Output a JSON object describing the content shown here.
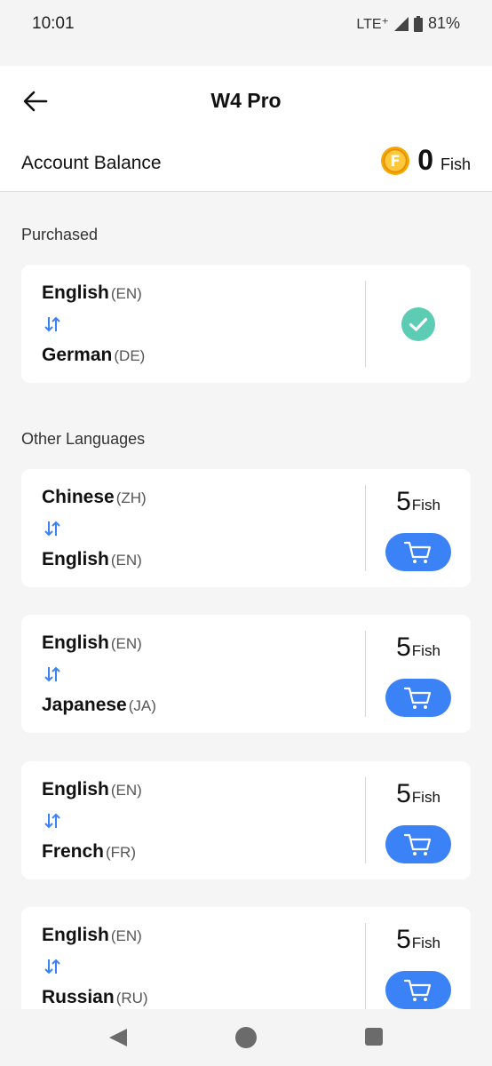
{
  "status_bar": {
    "time": "10:01",
    "network": "LTE⁺",
    "battery": "81%"
  },
  "header": {
    "title": "W4 Pro"
  },
  "balance": {
    "label": "Account Balance",
    "amount": "0",
    "unit": "Fish",
    "coin_icon": "coin-f-icon",
    "coin_letter": "F"
  },
  "sections": {
    "purchased": "Purchased",
    "other": "Other Languages"
  },
  "purchased": [
    {
      "from_name": "English",
      "from_code": "(EN)",
      "to_name": "German",
      "to_code": "(DE)",
      "status_icon": "check-circle-icon"
    }
  ],
  "other": [
    {
      "from_name": "Chinese",
      "from_code": "(ZH)",
      "to_name": "English",
      "to_code": "(EN)",
      "price": "5",
      "unit": "Fish"
    },
    {
      "from_name": "English",
      "from_code": "(EN)",
      "to_name": "Japanese",
      "to_code": "(JA)",
      "price": "5",
      "unit": "Fish"
    },
    {
      "from_name": "English",
      "from_code": "(EN)",
      "to_name": "French",
      "to_code": "(FR)",
      "price": "5",
      "unit": "Fish"
    },
    {
      "from_name": "English",
      "from_code": "(EN)",
      "to_name": "Russian",
      "to_code": "(RU)",
      "price": "5",
      "unit": "Fish"
    }
  ],
  "colors": {
    "accent": "#3b82f6",
    "check": "#5ccdb4",
    "coin": "#f5a623"
  }
}
